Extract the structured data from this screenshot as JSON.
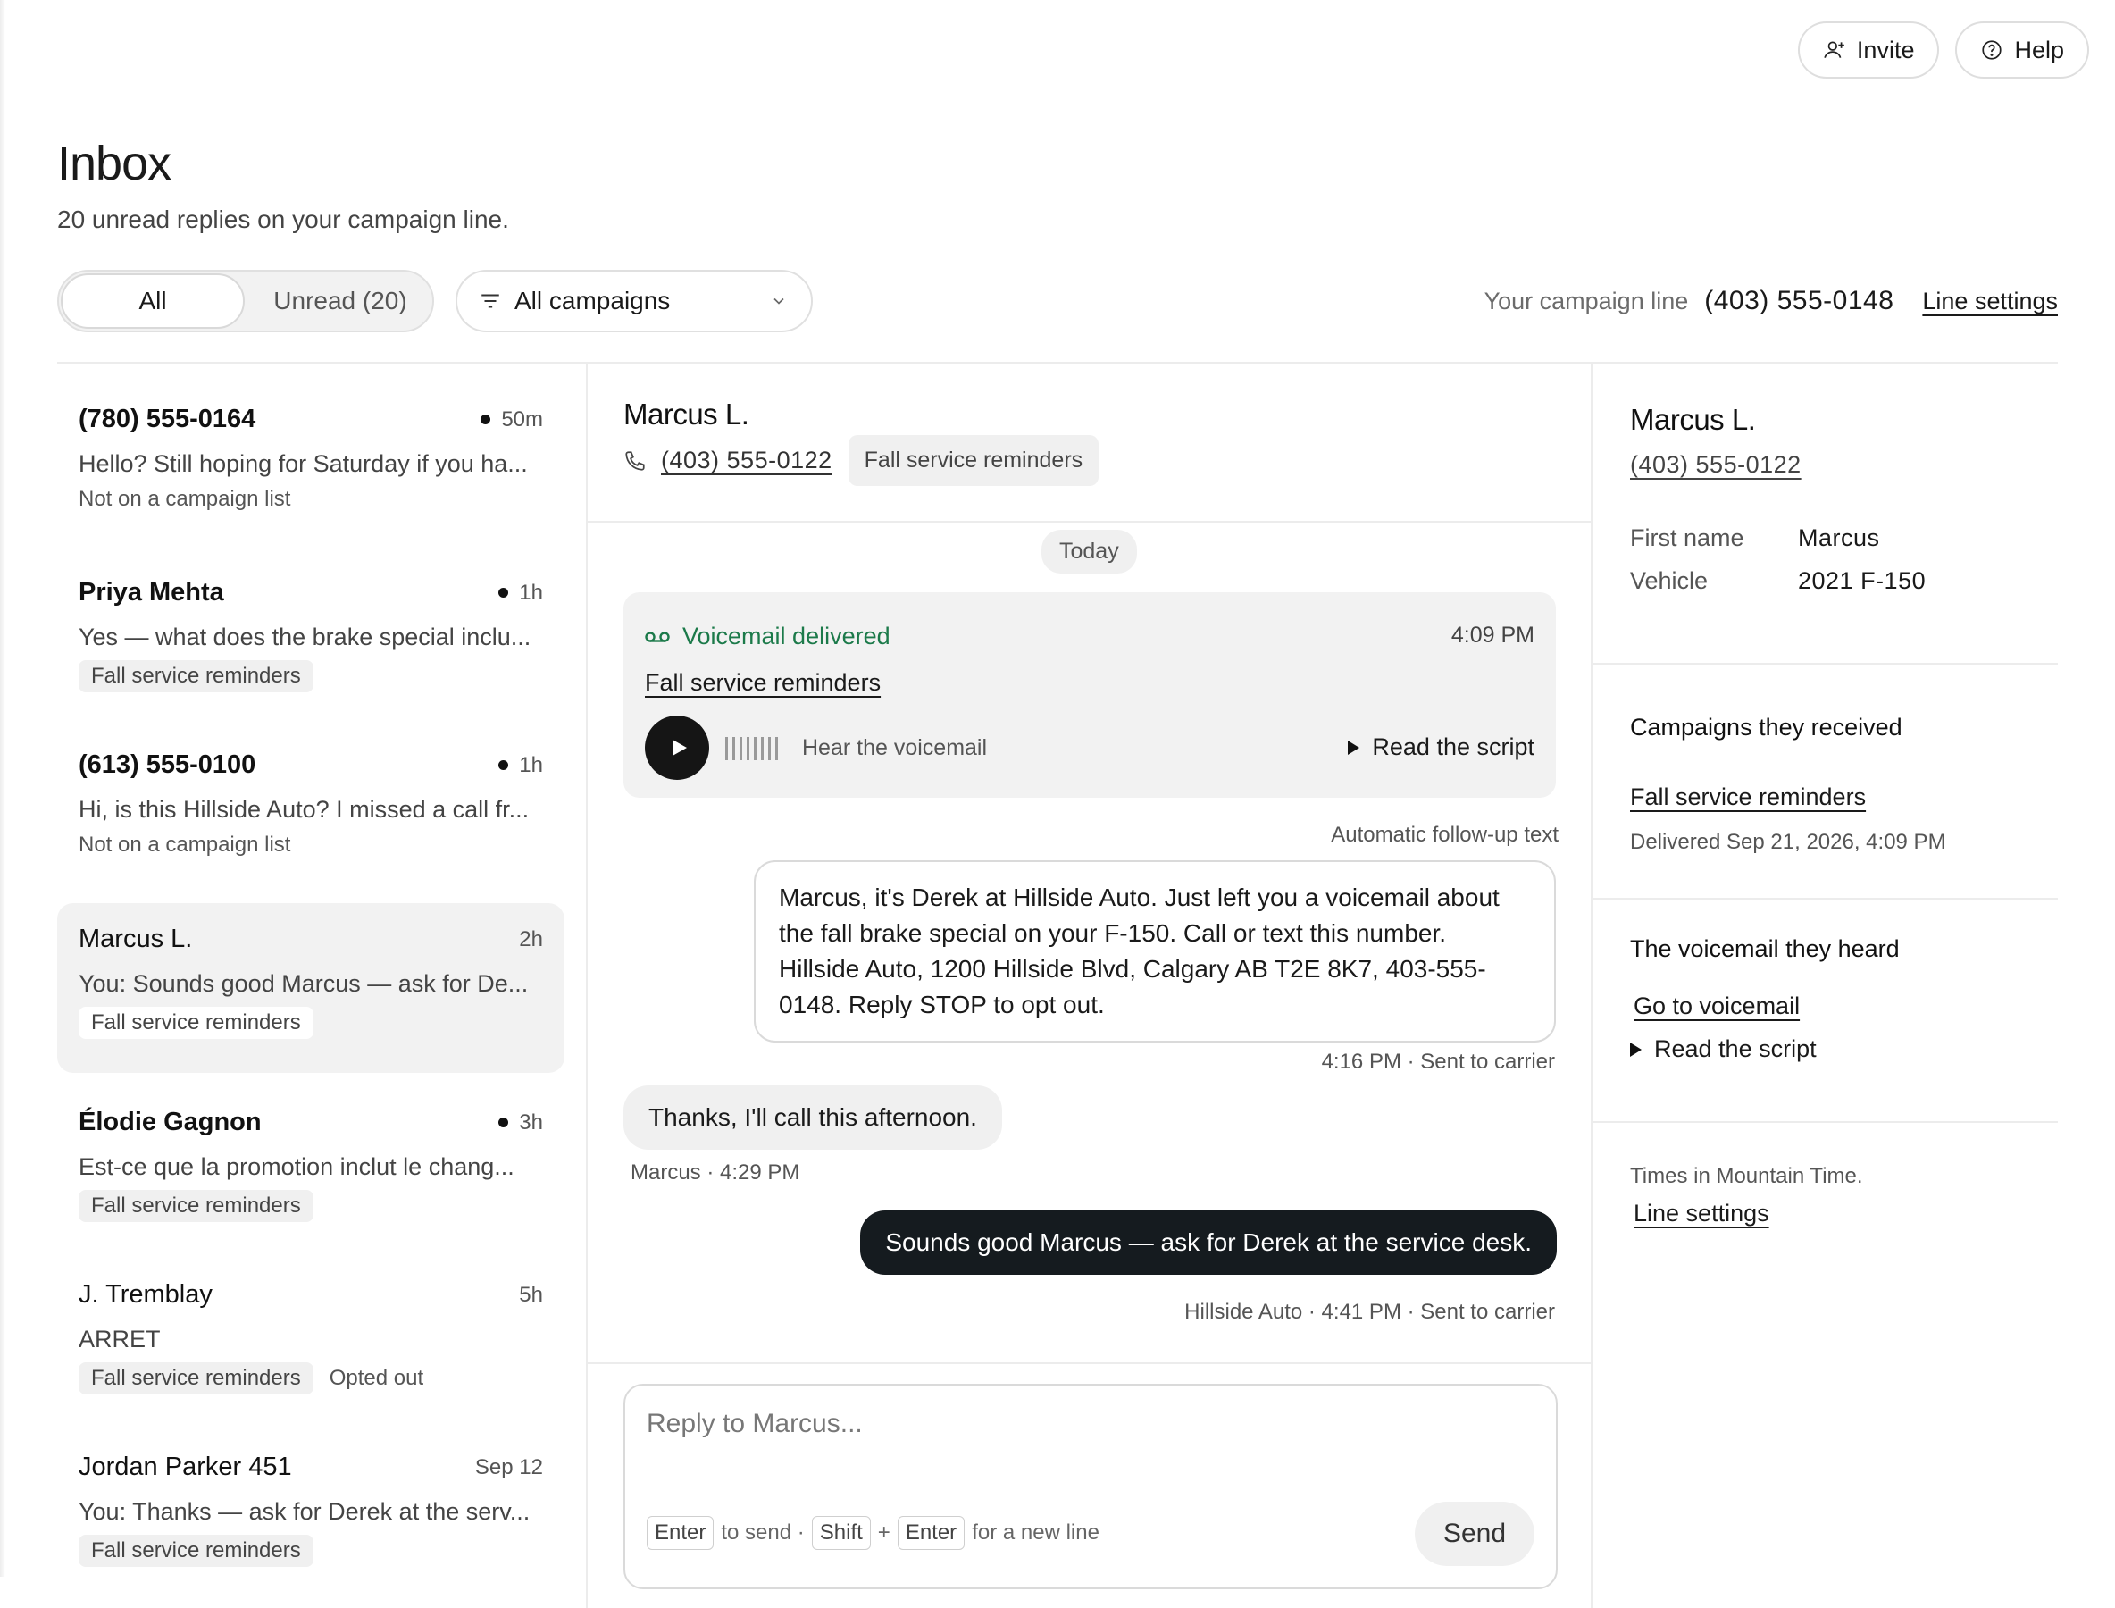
{
  "top_actions": {
    "invite": "Invite",
    "help": "Help"
  },
  "header": {
    "title": "Inbox",
    "subtitle": "20 unread replies on your campaign line."
  },
  "filters": {
    "all": "All",
    "unread": "Unread (20)",
    "campaign": "All campaigns"
  },
  "line": {
    "label": "Your campaign line",
    "number": "(403) 555-0148",
    "settings": "Line settings"
  },
  "conversations": [
    {
      "name": "(780) 555-0164",
      "time": "50m",
      "unread": true,
      "preview": "Hello? Still hoping for Saturday if you ha...",
      "meta": "Not on a campaign list"
    },
    {
      "name": "Priya Mehta",
      "time": "1h",
      "unread": true,
      "preview": "Yes — what does the brake special inclu...",
      "tag": "Fall service reminders"
    },
    {
      "name": "(613) 555-0100",
      "time": "1h",
      "unread": true,
      "preview": "Hi, is this Hillside Auto? I missed a call fr...",
      "meta": "Not on a campaign list"
    },
    {
      "name": "Marcus L.",
      "time": "2h",
      "unread": false,
      "preview": "You: Sounds good Marcus — ask for De...",
      "tag": "Fall service reminders"
    },
    {
      "name": "Élodie Gagnon",
      "time": "3h",
      "unread": true,
      "preview": "Est-ce que la promotion inclut le chang...",
      "tag": "Fall service reminders"
    },
    {
      "name": "J. Tremblay",
      "time": "5h",
      "unread": false,
      "preview": "ARRET",
      "tag": "Fall service reminders",
      "extra": "Opted out"
    },
    {
      "name": "Jordan Parker 451",
      "time": "Sep 12",
      "unread": false,
      "preview": "You: Thanks — ask for Derek at the serv...",
      "tag": "Fall service reminders"
    }
  ],
  "thread": {
    "name": "Marcus L.",
    "phone": "(403) 555-0122",
    "tag": "Fall service reminders",
    "day": "Today",
    "voicemail": {
      "status": "Voicemail delivered",
      "time": "4:09 PM",
      "campaign": "Fall service reminders",
      "hear": "Hear the voicemail",
      "script": "Read the script"
    },
    "auto_label": "Automatic follow-up text",
    "auto_text": "Marcus, it's Derek at Hillside Auto. Just left you a voicemail about the fall brake special on your F-150. Call or text this number. Hillside Auto, 1200 Hillside Blvd, Calgary AB T2E 8K7, 403-555-0148. Reply STOP to opt out.",
    "auto_meta": "4:16 PM · Sent to carrier",
    "reply_text": "Thanks, I'll call this afternoon.",
    "reply_meta": "Marcus · 4:29 PM",
    "sent_text": "Sounds good Marcus — ask for Derek at the service desk.",
    "sent_meta": "Hillside Auto · 4:41 PM · Sent to carrier",
    "composer": {
      "placeholder": "Reply to Marcus...",
      "enter": "Enter",
      "to_send": "to send ·",
      "shift": "Shift",
      "plus": "+",
      "enter2": "Enter",
      "new_line": "for a new line",
      "send": "Send"
    }
  },
  "contact": {
    "name": "Marcus L.",
    "phone": "(403) 555-0122",
    "first_name_label": "First name",
    "first_name": "Marcus",
    "vehicle_label": "Vehicle",
    "vehicle": "2021 F-150",
    "campaigns_heading": "Campaigns they received",
    "campaign_link": "Fall service reminders",
    "delivered": "Delivered Sep 21, 2026, 4:09 PM",
    "voicemail_heading": "The voicemail they heard",
    "voicemail_link": "Go to voicemail",
    "script": "Read the script",
    "timezone": "Times in Mountain Time.",
    "line_settings": "Line settings"
  },
  "colors": {
    "accent_green": "#1c7a4a",
    "dark_bubble": "#151b1f"
  }
}
